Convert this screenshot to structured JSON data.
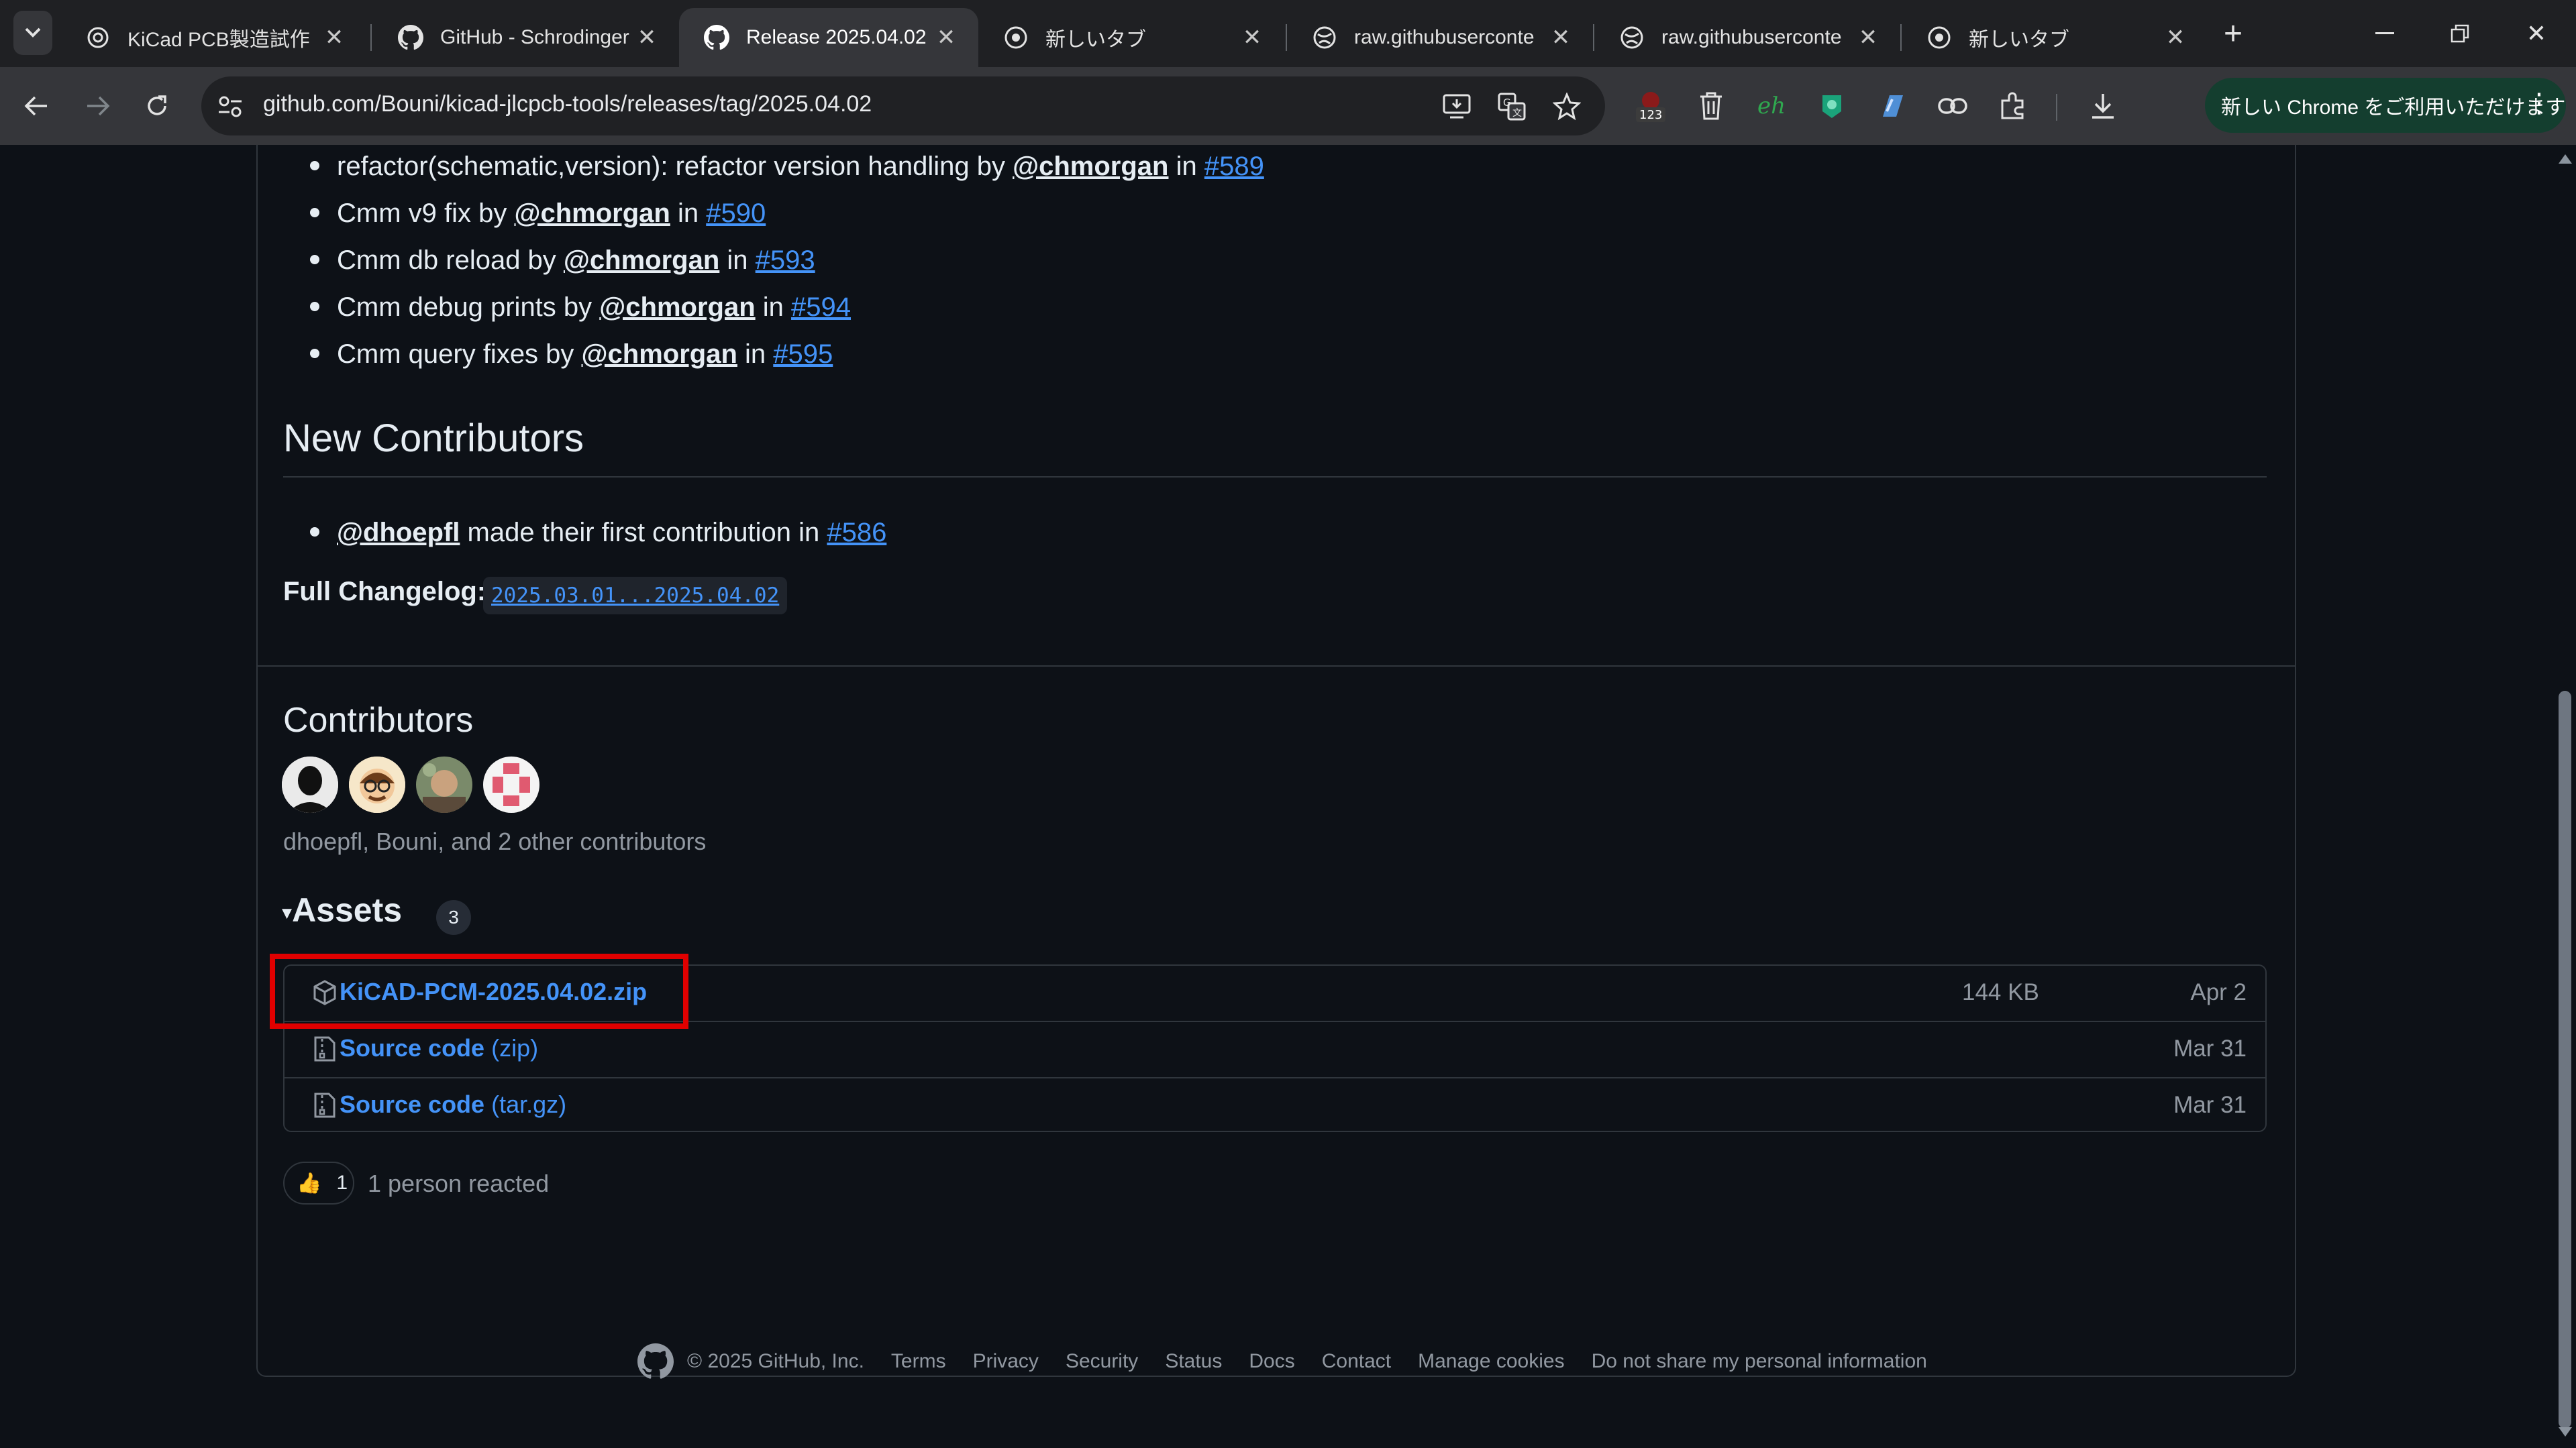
{
  "browser": {
    "tabs": [
      {
        "title": "KiCad PCB製造試作",
        "active": false
      },
      {
        "title": "GitHub - Schrodinger",
        "active": false
      },
      {
        "title": "Release 2025.04.02 · ",
        "active": true
      },
      {
        "title": "新しいタブ",
        "active": false
      },
      {
        "title": "raw.githubuserconte",
        "active": false
      },
      {
        "title": "raw.githubuserconte",
        "active": false
      },
      {
        "title": "新しいタブ",
        "active": false
      }
    ],
    "url": "github.com/Bouni/kicad-jlcpcb-tools/releases/tag/2025.04.02",
    "extension_badge": "123",
    "ext_eh_label": "eh",
    "update_button": "新しい Chrome をご利用いただけます"
  },
  "changes": [
    {
      "text": "refactor(schematic,version): refactor version handling by ",
      "author": "@chmorgan",
      "mid": " in ",
      "pr": "#589"
    },
    {
      "text": "Cmm v9 fix by ",
      "author": "@chmorgan",
      "mid": " in ",
      "pr": "#590"
    },
    {
      "text": "Cmm db reload by ",
      "author": "@chmorgan",
      "mid": " in ",
      "pr": "#593"
    },
    {
      "text": "Cmm debug prints by ",
      "author": "@chmorgan",
      "mid": " in ",
      "pr": "#594"
    },
    {
      "text": "Cmm query fixes by ",
      "author": "@chmorgan",
      "mid": " in ",
      "pr": "#595"
    }
  ],
  "new_contributors": {
    "heading": "New Contributors",
    "items": [
      {
        "author": "@dhoepfl",
        "text": " made their first contribution in ",
        "pr": "#586"
      }
    ]
  },
  "changelog": {
    "label": "Full Changelog:",
    "link": "2025.03.01...2025.04.02"
  },
  "contributors": {
    "heading": "Contributors",
    "text": "dhoepfl, Bouni, and 2 other contributors"
  },
  "assets": {
    "heading": "Assets",
    "count": "3",
    "items": [
      {
        "name": "KiCAD-PCM-2025.04.02.zip",
        "suffix": "",
        "size": "144 KB",
        "date": "Apr 2"
      },
      {
        "name": "Source code",
        "suffix": " (zip)",
        "size": "",
        "date": "Mar 31"
      },
      {
        "name": "Source code",
        "suffix": " (tar.gz)",
        "size": "",
        "date": "Mar 31"
      }
    ]
  },
  "reactions": {
    "emoji": "👍",
    "count": "1",
    "text": "1 person reacted"
  },
  "footer": {
    "copyright": "© 2025 GitHub, Inc.",
    "links": [
      "Terms",
      "Privacy",
      "Security",
      "Status",
      "Docs",
      "Contact",
      "Manage cookies",
      "Do not share my personal information"
    ]
  }
}
